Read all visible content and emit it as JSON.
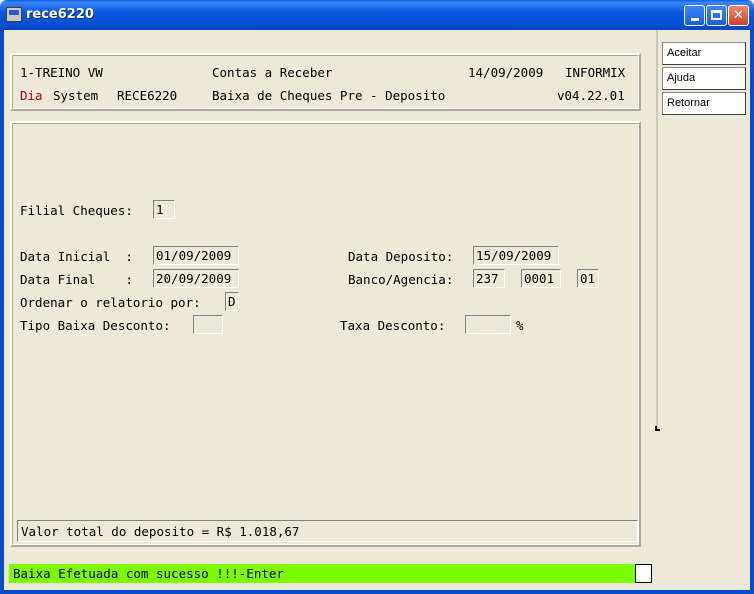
{
  "window": {
    "title": "rece6220",
    "icon": "terminal-app-icon"
  },
  "titlebar_buttons": [
    "minimize",
    "maximize",
    "close"
  ],
  "side_buttons": [
    "Aceitar",
    "Ajuda",
    "Retornar"
  ],
  "header": {
    "company": "1-TREINO VW",
    "module": "Contas a Receber",
    "date": "14/09/2009",
    "db": "INFORMIX",
    "dia": "Dia",
    "system": "System",
    "program": "RECE6220",
    "screen_title": "Baixa de Cheques Pre - Deposito",
    "version": "v04.22.01"
  },
  "form": {
    "filial_label": "Filial Cheques:",
    "filial_value": "1",
    "data_inicial_label": "Data Inicial  :",
    "data_inicial_value": "01/09/2009",
    "data_final_label": "Data Final    :",
    "data_final_value": "20/09/2009",
    "ordenar_label": "Ordenar o relatorio por:",
    "ordenar_value": "D",
    "tipo_baixa_label": "Tipo Baixa Desconto:",
    "tipo_baixa_value": "",
    "data_deposito_label": "Data Deposito:",
    "data_deposito_value": "15/09/2009",
    "banco_label": "Banco/Agencia:",
    "banco_value": "237",
    "agencia_value": "0001",
    "agencia_dv_value": "01",
    "taxa_label": "Taxa Desconto:",
    "taxa_value": "",
    "percent": "%"
  },
  "total": "Valor total do deposito = R$ 1.018,67",
  "status": "Baixa Efetuada com sucesso !!!-Enter",
  "colors": {
    "titlebar": "#0a58e0",
    "status_bg": "#7dfc00",
    "dia_red": "#c00000",
    "window_bg": "#ece9d8"
  }
}
